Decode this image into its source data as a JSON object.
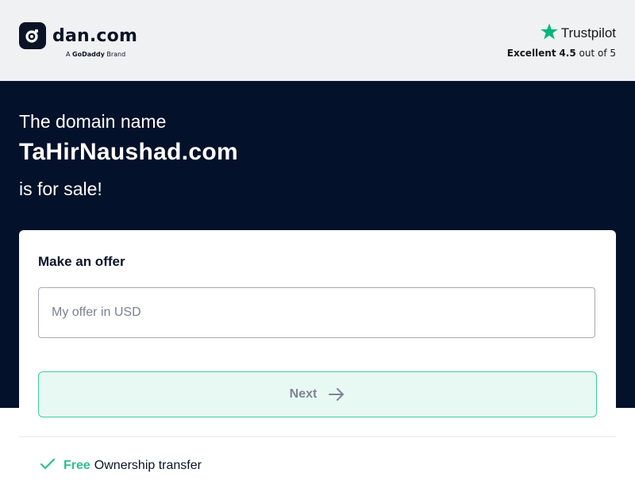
{
  "header": {
    "logo_text": "dan.com",
    "logo_sub_prefix": "A",
    "logo_sub_brand": "GoDaddy",
    "logo_sub_suffix": "Brand",
    "trustpilot": {
      "name": "Trustpilot",
      "rating_label": "Excellent",
      "rating_value": "4.5",
      "rating_suffix": "out of 5"
    }
  },
  "hero": {
    "line1": "The domain name",
    "domain": "TaHirNaushad.com",
    "line3": "is for sale!"
  },
  "offer": {
    "title": "Make an offer",
    "input_placeholder": "My offer in USD",
    "input_value": "",
    "next_label": "Next"
  },
  "features": [
    {
      "highlight": "Free",
      "text": "Ownership transfer"
    }
  ],
  "colors": {
    "header_bg": "#f0f1f3",
    "hero_bg": "#04112a",
    "accent_green": "#3ccf9c",
    "button_bg": "#e8f8f3",
    "trustpilot_star": "#00b67a"
  },
  "icons": [
    "dan-logo-icon",
    "trustpilot-star-icon",
    "arrow-right-icon",
    "checkmark-icon"
  ]
}
